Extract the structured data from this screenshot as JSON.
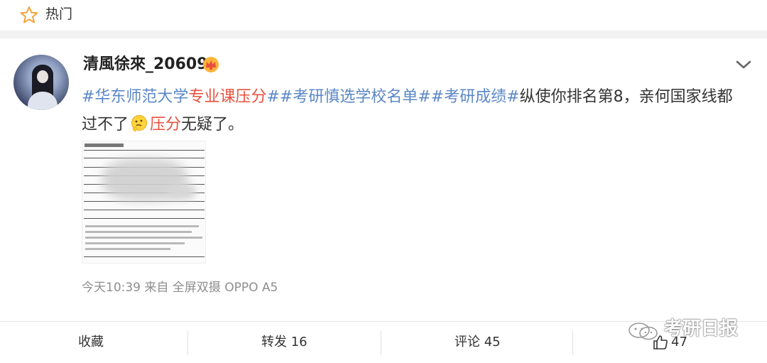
{
  "header": {
    "label": "热门"
  },
  "post": {
    "username": "清風徐來_20609",
    "text_segments": [
      {
        "t": "#华东师范大学",
        "c": "tag"
      },
      {
        "t": "专业课压分",
        "c": "hl"
      },
      {
        "t": "##考研慎选学校名单##考研成绩#",
        "c": "tag"
      },
      {
        "t": "纵使你排名第8，亲何国家线都过不了",
        "c": "plain"
      },
      {
        "t": "压分",
        "c": "hl"
      },
      {
        "t": "无疑了。",
        "c": "plain"
      }
    ],
    "meta": "今天10:39 来自 全屏双摄 OPPO A5"
  },
  "actions": {
    "favorite": "收藏",
    "repost": "转发 16",
    "comment": "评论 45",
    "likes": "47"
  },
  "watermark": {
    "text": "考研日报"
  },
  "colors": {
    "tag": "#5b87c6",
    "highlight": "#e8503f",
    "meta": "#8e8e8e",
    "band": "#f2f2f2"
  }
}
